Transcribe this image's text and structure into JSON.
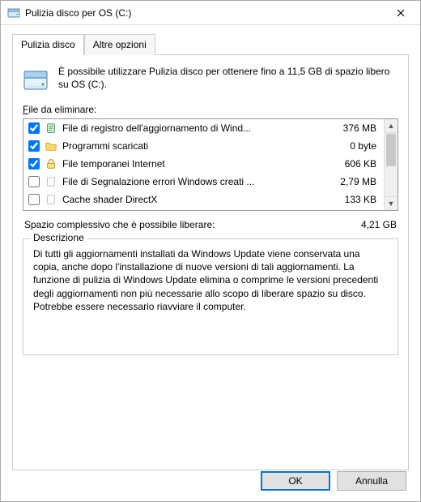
{
  "window": {
    "title": "Pulizia disco per OS (C:)"
  },
  "tabs": {
    "main": "Pulizia disco",
    "other": "Altre opzioni"
  },
  "intro": "È possibile utilizzare Pulizia disco per ottenere fino a 11,5 GB di spazio libero su OS (C:).",
  "files_label": "File da eliminare:",
  "items": [
    {
      "checked": true,
      "icon": "log-icon",
      "name": "File di registro dell'aggiornamento di Wind...",
      "size": "376 MB"
    },
    {
      "checked": true,
      "icon": "folder-icon",
      "name": "Programmi scaricati",
      "size": "0 byte"
    },
    {
      "checked": true,
      "icon": "lock-icon",
      "name": "File temporanei Internet",
      "size": "606 KB"
    },
    {
      "checked": false,
      "icon": "blank-icon",
      "name": "File di Segnalazione errori Windows creati ...",
      "size": "2,79 MB"
    },
    {
      "checked": false,
      "icon": "blank-icon",
      "name": "Cache shader DirectX",
      "size": "133 KB"
    }
  ],
  "total": {
    "label": "Spazio complessivo che è possibile liberare:",
    "value": "4,21 GB"
  },
  "description": {
    "label": "Descrizione",
    "text": "Di tutti gli aggiornamenti installati da Windows Update viene conservata una copia, anche dopo l'installazione di nuove versioni di tali aggiornamenti. La funzione di pulizia di Windows Update elimina o comprime le versioni precedenti degli aggiornamenti non più necessarie allo scopo di liberare spazio su disco. Potrebbe essere necessario riavviare il computer."
  },
  "buttons": {
    "ok": "OK",
    "cancel": "Annulla"
  }
}
